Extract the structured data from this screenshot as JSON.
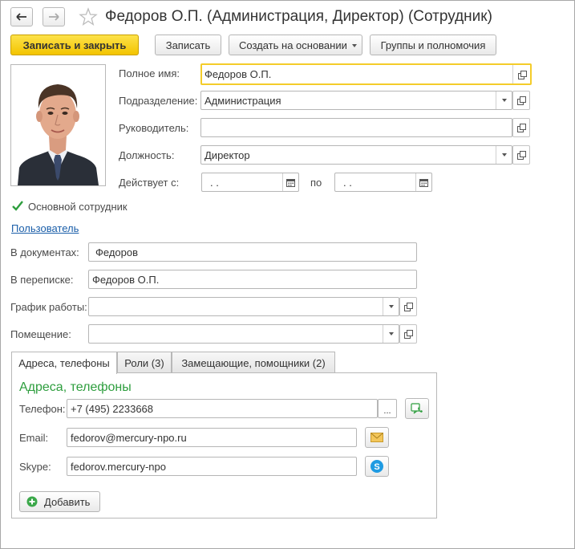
{
  "window": {
    "title": "Федоров О.П. (Администрация, Директор) (Сотрудник)"
  },
  "toolbar": {
    "save_close_label": "Записать и закрыть",
    "save_label": "Записать",
    "create_based_label": "Создать на основании",
    "groups_label": "Группы и полномочия"
  },
  "form": {
    "full_name": {
      "label": "Полное имя:",
      "value": "Федоров О.П."
    },
    "department": {
      "label": "Подразделение:",
      "value": "Администрация"
    },
    "manager": {
      "label": "Руководитель:",
      "value": ""
    },
    "position": {
      "label": "Должность:",
      "value": "Директор"
    },
    "valid_from": {
      "label": "Действует с:",
      "value": " .  .",
      "to_label": "по",
      "to_value": " .  ."
    },
    "main_employee": {
      "label": "Основной сотрудник",
      "checked": true
    },
    "user_link": "Пользователь",
    "in_documents": {
      "label": "В документах:",
      "value": "Федоров"
    },
    "in_correspondence": {
      "label": "В переписке:",
      "value": "Федоров О.П."
    },
    "schedule": {
      "label": "График работы:",
      "value": ""
    },
    "room": {
      "label": "Помещение:",
      "value": ""
    }
  },
  "tabs": [
    {
      "label": "Адреса, телефоны",
      "active": true
    },
    {
      "label": "Роли (3)",
      "active": false
    },
    {
      "label": "Замещающие, помощники (2)",
      "active": false
    }
  ],
  "contacts": {
    "heading": "Адреса, телефоны",
    "phone": {
      "label": "Телефон:",
      "value": "+7 (495) 2233668",
      "more": "..."
    },
    "email": {
      "label": "Email:",
      "value": "fedorov@mercury-npo.ru"
    },
    "skype": {
      "label": "Skype:",
      "value": "fedorov.mercury-npo"
    },
    "add_label": "Добавить"
  },
  "colors": {
    "accent_yellow": "#f3c400",
    "heading_green": "#2e9e3e",
    "link_blue": "#1a5ea9"
  }
}
